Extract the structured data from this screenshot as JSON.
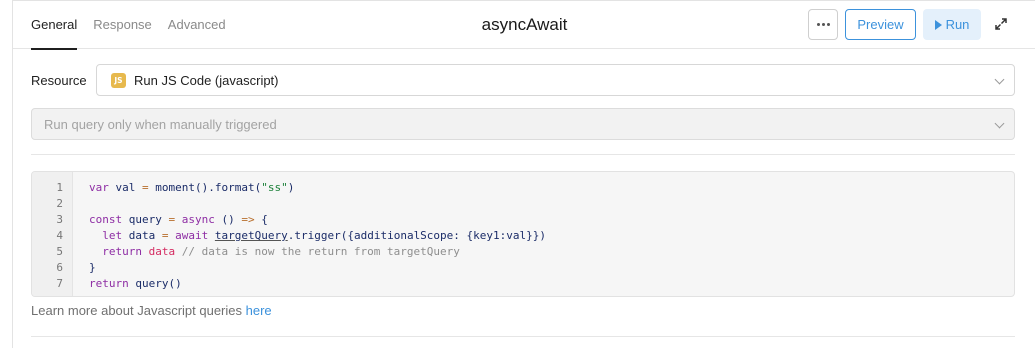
{
  "header": {
    "tabs": [
      {
        "label": "General",
        "active": true
      },
      {
        "label": "Response",
        "active": false
      },
      {
        "label": "Advanced",
        "active": false
      }
    ],
    "title": "asyncAwait",
    "more_icon": "ellipsis-icon",
    "preview_label": "Preview",
    "run_label": "Run",
    "run_icon": "play-icon",
    "expand_icon": "expand-icon"
  },
  "resource": {
    "label": "Resource",
    "badge": "JS",
    "value": "Run JS Code (javascript)"
  },
  "trigger": {
    "value": "Run query only when manually triggered"
  },
  "editor": {
    "line_numbers": [
      "1",
      "2",
      "3",
      "4",
      "5",
      "6",
      "7"
    ],
    "lines": [
      "var val = moment().format(\"ss\")",
      "",
      "const query = async () => {",
      "  let data = await targetQuery.trigger({additionalScope: {key1:val}})",
      "  return data // data is now the return from targetQuery",
      "}",
      "return query()"
    ]
  },
  "footer": {
    "learn_text": "Learn more about Javascript queries ",
    "learn_link": "here"
  },
  "colors": {
    "accent": "#3c92dc",
    "js_badge": "#e7b94d",
    "keyword": "#8e2da4",
    "string": "#1a7f37"
  }
}
